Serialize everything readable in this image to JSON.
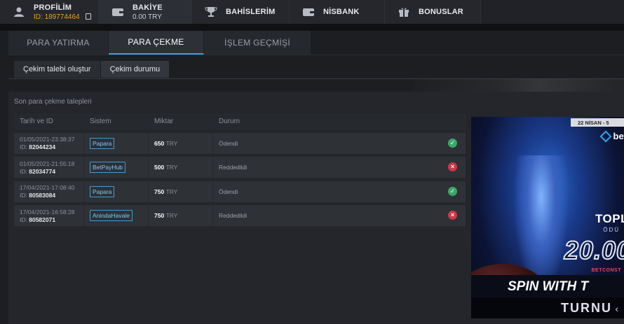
{
  "nav": {
    "profile": {
      "title": "PROFİLİM",
      "id_label": "ID:",
      "id_value": "189774464"
    },
    "balance": {
      "title": "BAKİYE",
      "value": "0.00 TRY"
    },
    "bets": {
      "title": "BAHİSLERİM"
    },
    "bank": {
      "title": "NİSBANK"
    },
    "bonus": {
      "title": "BONUSLAR"
    }
  },
  "tabs": [
    "PARA YATIRMA",
    "PARA ÇEKME",
    "İŞLEM GEÇMİŞİ"
  ],
  "subtabs": [
    "Çekim talebi oluştur",
    "Çekim durumu"
  ],
  "section_title": "Son para çekme talepleri",
  "table": {
    "headers": [
      "Tarih ve ID",
      "Sistem",
      "Miktar",
      "Durum"
    ],
    "rows": [
      {
        "date": "01/05/2021-23:38:37",
        "id_label": "ID:",
        "id": "82044234",
        "system": "Papara",
        "amount": "650",
        "currency": "TRY",
        "status": "Ödendi",
        "status_type": "ok"
      },
      {
        "date": "01/05/2021-21:55:18",
        "id_label": "ID:",
        "id": "82034774",
        "system": "BetPayHub",
        "amount": "500",
        "currency": "TRY",
        "status": "Reddedildi",
        "status_type": "bad"
      },
      {
        "date": "17/04/2021-17:08:40",
        "id_label": "ID:",
        "id": "80583084",
        "system": "Papara",
        "amount": "750",
        "currency": "TRY",
        "status": "Ödendi",
        "status_type": "ok"
      },
      {
        "date": "17/04/2021-16:58:28",
        "id_label": "ID:",
        "id": "80582071",
        "system": "AnindaHavale",
        "amount": "750",
        "currency": "TRY",
        "status": "Reddedildi",
        "status_type": "bad"
      }
    ]
  },
  "banner": {
    "date": "22 NİSAN - 5",
    "logo": "bet",
    "topl": "TOPL",
    "odu": "ÖDÜ",
    "prize": "20.00",
    "brand": "BETCONST",
    "spin": "SPIN WITH T",
    "turnu": "TURNU"
  },
  "colors": {
    "accent": "#2fa4e7",
    "ok": "#3da66a",
    "bad": "#c9394a",
    "highlight": "#e6a21a"
  }
}
